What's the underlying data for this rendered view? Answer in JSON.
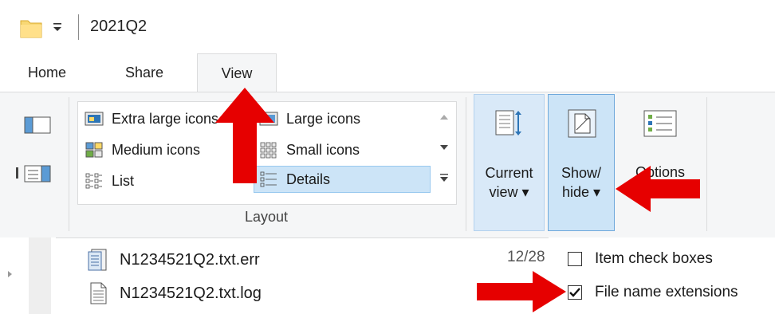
{
  "window": {
    "title": "2021Q2",
    "folder_icon": "folder-icon",
    "quick_access_dropdown": "quick-access-dropdown-icon"
  },
  "tabs": [
    {
      "label": "Home"
    },
    {
      "label": "Share"
    },
    {
      "label": "View",
      "active": true
    }
  ],
  "ribbon": {
    "panes": {
      "navigation_pane_icon": "navigation-pane-icon",
      "details_pane_icon": "details-pane-icon"
    },
    "layout": {
      "group_label": "Layout",
      "items": [
        {
          "label": "Extra large icons",
          "icon": "extra-large-icons-icon"
        },
        {
          "label": "Large icons",
          "icon": "large-icons-icon"
        },
        {
          "label": "Medium icons",
          "icon": "medium-icons-icon"
        },
        {
          "label": "Small icons",
          "icon": "small-icons-icon"
        },
        {
          "label": "List",
          "icon": "list-icon"
        },
        {
          "label": "Details",
          "icon": "details-icon",
          "selected": true
        }
      ]
    },
    "current_view": {
      "line1": "Current",
      "line2": "view ▾"
    },
    "show_hide": {
      "line1": "Show/",
      "line2": "hide ▾"
    },
    "options": {
      "label": "Options"
    }
  },
  "files": [
    {
      "name": "N1234521Q2.txt.err",
      "date": "12/28",
      "icon": "error-file-icon"
    },
    {
      "name": "N1234521Q2.txt.log",
      "icon": "text-file-icon"
    }
  ],
  "show_hide_menu": [
    {
      "label": "Item check boxes",
      "checked": false
    },
    {
      "label": "File name extensions",
      "checked": true
    }
  ],
  "colors": {
    "arrow": "#e60000",
    "ribbon_bg": "#f5f6f7",
    "selected_bg": "#cce4f7",
    "selected_border": "#6fa9dc"
  }
}
